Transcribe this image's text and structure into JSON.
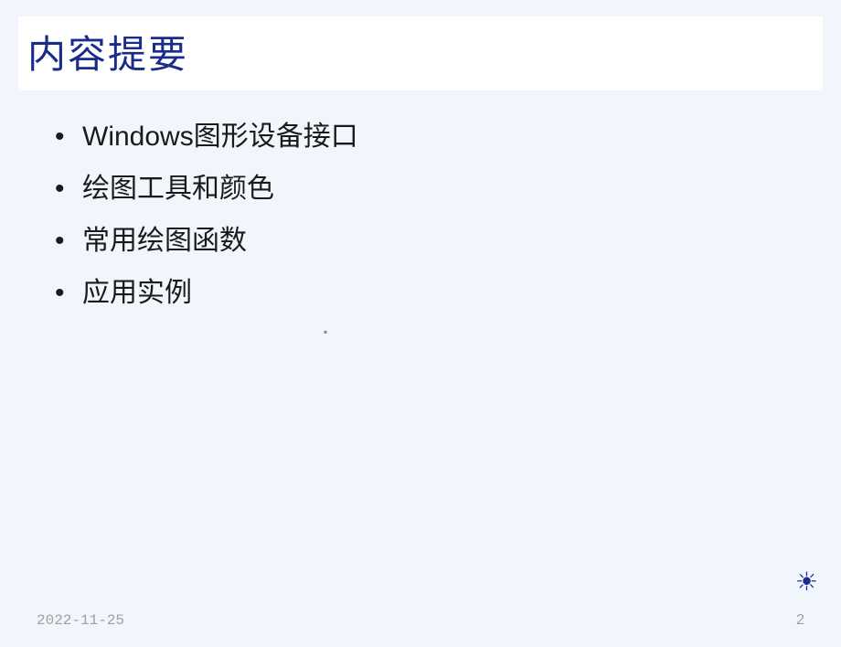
{
  "slide": {
    "title": "内容提要",
    "bullets": [
      "Windows图形设备接口",
      "绘图工具和颜色",
      "常用绘图函数",
      "应用实例"
    ],
    "center_mark": "▪",
    "footer": {
      "date": "2022-11-25",
      "page": "2"
    },
    "decoration": {
      "sun": "☀"
    }
  }
}
